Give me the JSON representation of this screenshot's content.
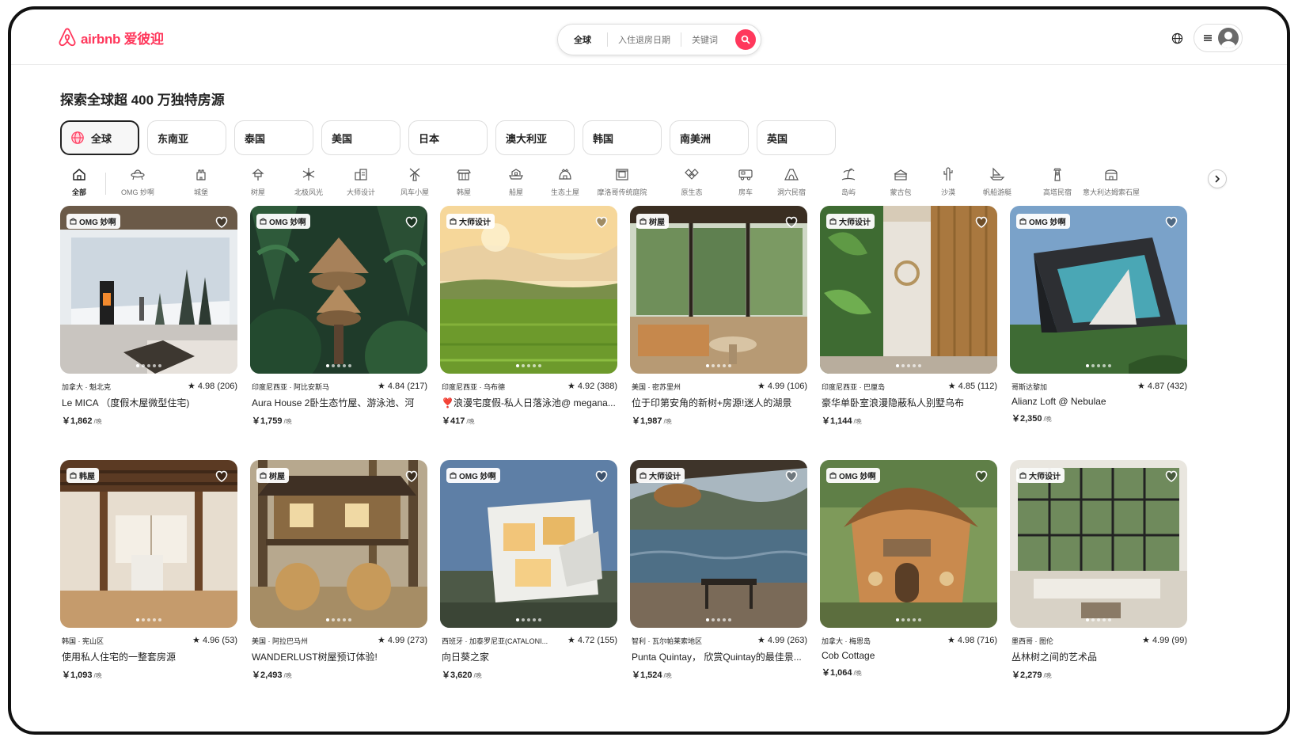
{
  "header": {
    "logo_text": "airbnb 爱彼迎",
    "search": {
      "where": "全球",
      "when": "入住退房日期",
      "what": "关键词"
    }
  },
  "page_title": "探索全球超 400 万独特房源",
  "regions": [
    "全球",
    "东南亚",
    "泰国",
    "美国",
    "日本",
    "澳大利亚",
    "韩国",
    "南美洲",
    "英国"
  ],
  "categories": [
    {
      "label": "全部",
      "icon": "home-icon"
    },
    {
      "label": "OMG 妙啊",
      "icon": "ufo-icon"
    },
    {
      "label": "城堡",
      "icon": "castle-icon"
    },
    {
      "label": "树屋",
      "icon": "treehouse-icon"
    },
    {
      "label": "北极风光",
      "icon": "snowflake-icon"
    },
    {
      "label": "大师设计",
      "icon": "design-icon"
    },
    {
      "label": "风车小屋",
      "icon": "windmill-icon"
    },
    {
      "label": "韩屋",
      "icon": "hanok-icon"
    },
    {
      "label": "船屋",
      "icon": "houseboat-icon"
    },
    {
      "label": "生态土屋",
      "icon": "earth-home-icon"
    },
    {
      "label": "摩洛哥传统庭院",
      "icon": "riad-icon"
    },
    {
      "label": "原生态",
      "icon": "off-grid-icon"
    },
    {
      "label": "房车",
      "icon": "camper-icon"
    },
    {
      "label": "洞穴民宿",
      "icon": "cave-icon"
    },
    {
      "label": "岛屿",
      "icon": "island-icon"
    },
    {
      "label": "蒙古包",
      "icon": "yurt-icon"
    },
    {
      "label": "沙漠",
      "icon": "cactus-icon"
    },
    {
      "label": "帆船游艇",
      "icon": "boat-icon"
    },
    {
      "label": "高塔民宿",
      "icon": "tower-icon"
    },
    {
      "label": "意大利达姆索石屋",
      "icon": "dammuso-icon"
    }
  ],
  "listings": [
    {
      "badge": "OMG 妙啊",
      "location": "加拿大 · 魁北克",
      "rating": "★ 4.98 (206)",
      "title": "Le MICA （度假木屋微型住宅)",
      "price": "￥1,862",
      "per": "/晚"
    },
    {
      "badge": "OMG 妙啊",
      "location": "印度尼西亚 · 阿比安斯马",
      "rating": "★ 4.84 (217)",
      "title": "Aura House 2卧生态竹屋、游泳池、河",
      "price": "￥1,759",
      "per": "/晚"
    },
    {
      "badge": "大师设计",
      "location": "印度尼西亚 · 乌布德",
      "rating": "★ 4.92 (388)",
      "title": "❣️浪漫宅度假-私人日落泳池@ megana...",
      "price": "￥417",
      "per": "/晚"
    },
    {
      "badge": "树屋",
      "location": "美国 · 密苏里州",
      "rating": "★ 4.99 (106)",
      "title": "位于印第安角的新树+房源!迷人的湖景",
      "price": "￥1,987",
      "per": "/晚"
    },
    {
      "badge": "大师设计",
      "location": "印度尼西亚 · 巴厘岛",
      "rating": "★ 4.85 (112)",
      "title": "豪华单卧室浪漫隐蔽私人别墅乌布",
      "price": "￥1,144",
      "per": "/晚"
    },
    {
      "badge": "OMG 妙啊",
      "location": "哥斯达黎加",
      "rating": "★ 4.87 (432)",
      "title": "Alianz Loft @ Nebulae",
      "price": "￥2,350",
      "per": "/晚"
    },
    {
      "badge": "韩屋",
      "location": "韩国 · 宪山区",
      "rating": "★ 4.96 (53)",
      "title": "使用私人住宅的一整套房源",
      "price": "￥1,093",
      "per": "/晚"
    },
    {
      "badge": "树屋",
      "location": "美国 · 阿拉巴马州",
      "rating": "★ 4.99 (273)",
      "title": "WANDERLUST树屋预订体验!",
      "price": "￥2,493",
      "per": "/晚"
    },
    {
      "badge": "OMG 妙啊",
      "location": "西班牙 · 加泰罗尼亚(CATALONI...",
      "rating": "★ 4.72 (155)",
      "title": "向日葵之家",
      "price": "￥3,620",
      "per": "/晚"
    },
    {
      "badge": "大师设计",
      "location": "智利 · 瓦尔帕莱索地区",
      "rating": "★ 4.99 (263)",
      "title": "Punta Quintay， 欣赏Quintay的最佳景...",
      "price": "￥1,524",
      "per": "/晚"
    },
    {
      "badge": "OMG 妙啊",
      "location": "加拿大 · 梅恩岛",
      "rating": "★ 4.98 (716)",
      "title": "Cob Cottage",
      "price": "￥1,064",
      "per": "/晚"
    },
    {
      "badge": "大师设计",
      "location": "墨西哥 · 图伦",
      "rating": "★ 4.99 (99)",
      "title": "丛林树之间的艺术品",
      "price": "￥2,279",
      "per": "/晚"
    }
  ],
  "colors": {
    "brand": "#ff385c",
    "text": "#222222",
    "muted": "#717171",
    "border": "#dddddd"
  }
}
